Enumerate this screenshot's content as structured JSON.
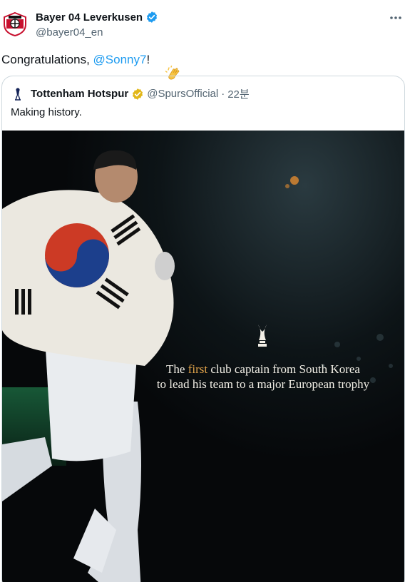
{
  "tweet": {
    "display_name": "Bayer 04 Leverkusen",
    "handle": "@bayer04_en",
    "text_prefix": "Congratulations, ",
    "mention": "@Sonny7",
    "text_suffix": "!",
    "avatar_icon": "bayer-leverkusen-crest-icon",
    "verified_icon": "verified-badge-blue-icon",
    "more_icon": "more-options-icon",
    "emoji": "clapping-hands-icon"
  },
  "quote": {
    "display_name": "Tottenham Hotspur",
    "handle": "@SpursOfficial",
    "separator": "·",
    "time": "22분",
    "text": "Making history.",
    "logo_icon": "spurs-cockerel-icon",
    "verified_icon": "verified-badge-gold-icon"
  },
  "media": {
    "caption_pre": "The ",
    "caption_highlight": "first",
    "caption_line1_rest": " club captain from South Korea",
    "caption_line2": "to lead his team to a major European trophy",
    "trophy_icon": "europa-trophy-icon",
    "highlight_color": "#e0a24a"
  },
  "colors": {
    "link": "#1d9bf0",
    "secondary_text": "#536471",
    "border": "#cfd9de"
  }
}
